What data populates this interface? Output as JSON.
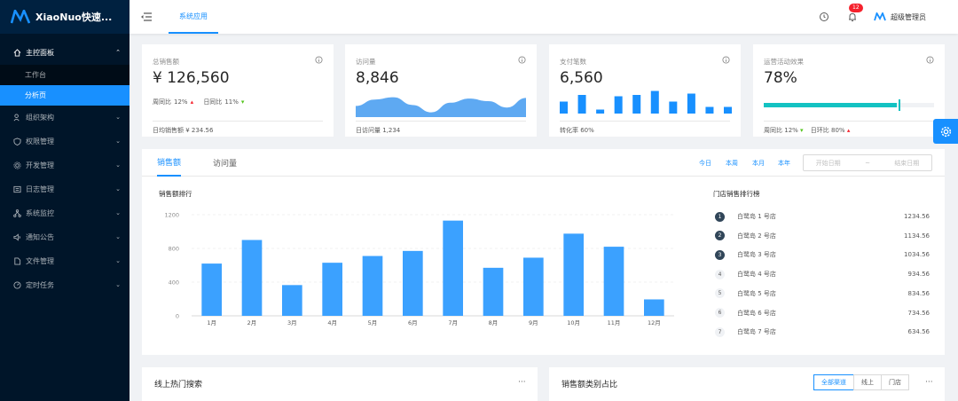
{
  "sidebar": {
    "logo": "XiaoNuo快速...",
    "items": [
      {
        "label": "主控面板",
        "icon": "home-icon"
      },
      {
        "label": "组织架构",
        "icon": "team-icon"
      },
      {
        "label": "权限管理",
        "icon": "safety-icon"
      },
      {
        "label": "开发管理",
        "icon": "setting-icon"
      },
      {
        "label": "日志管理",
        "icon": "log-icon"
      },
      {
        "label": "系统监控",
        "icon": "cluster-icon"
      },
      {
        "label": "通知公告",
        "icon": "sound-icon"
      },
      {
        "label": "文件管理",
        "icon": "file-icon"
      },
      {
        "label": "定时任务",
        "icon": "dashboard-icon"
      }
    ],
    "subitems": [
      {
        "label": "工作台"
      },
      {
        "label": "分析页"
      }
    ]
  },
  "header": {
    "tab": "系统应用",
    "badge": "12",
    "user": "超级管理员"
  },
  "kpi": [
    {
      "title": "总销售额",
      "value": "¥ 126,560",
      "week_label": "周同比",
      "week_val": "12%",
      "day_label": "日同比",
      "day_val": "11%",
      "foot": "日均销售额 ¥ 234.56"
    },
    {
      "title": "访问量",
      "value": "8,846",
      "foot": "日访问量 1,234"
    },
    {
      "title": "支付笔数",
      "value": "6,560",
      "foot": "转化率 60%"
    },
    {
      "title": "运营活动效果",
      "value": "78%",
      "progress": 0.78,
      "week_label": "周同比",
      "week_val": "12%",
      "day_label": "日环比",
      "day_val": "80%"
    }
  ],
  "sales": {
    "tabs": [
      "销售额",
      "访问量"
    ],
    "ranges": [
      "今日",
      "本周",
      "本月",
      "本年"
    ],
    "date_start": "开始日期",
    "date_sep": "~",
    "date_end": "结束日期",
    "chart_title": "销售额排行",
    "rank_title": "门店销售排行榜",
    "ranking": [
      {
        "n": "1",
        "name": "白鹭岛 1 号店",
        "value": "1234.56"
      },
      {
        "n": "2",
        "name": "白鹭岛 2 号店",
        "value": "1134.56"
      },
      {
        "n": "3",
        "name": "白鹭岛 3 号店",
        "value": "1034.56"
      },
      {
        "n": "4",
        "name": "白鹭岛 4 号店",
        "value": "934.56"
      },
      {
        "n": "5",
        "name": "白鹭岛 5 号店",
        "value": "834.56"
      },
      {
        "n": "6",
        "name": "白鹭岛 6 号店",
        "value": "734.56"
      },
      {
        "n": "7",
        "name": "白鹭岛 7 号店",
        "value": "634.56"
      }
    ]
  },
  "bottom": {
    "left_title": "线上热门搜索",
    "right_title": "销售额类别占比",
    "more": "···",
    "seg": [
      "全部渠道",
      "线上",
      "门店"
    ]
  },
  "colors": {
    "accent": "#1890ff",
    "sidebar": "#001529",
    "progress": "#13c2c2"
  },
  "chart_data": {
    "type": "bar",
    "categories": [
      "1月",
      "2月",
      "3月",
      "4月",
      "5月",
      "6月",
      "7月",
      "8月",
      "9月",
      "10月",
      "11月",
      "12月"
    ],
    "values": [
      620,
      900,
      365,
      630,
      710,
      770,
      1130,
      570,
      690,
      975,
      820,
      195
    ],
    "title": "销售额排行",
    "ylim": [
      0,
      1200
    ],
    "yticks": [
      0,
      400,
      800,
      1200
    ],
    "grid": true,
    "color": "#3ba1ff"
  },
  "mini": {
    "area": [
      0.35,
      0.55,
      0.62,
      0.38,
      0.15,
      0.45,
      0.58,
      0.5,
      0.3,
      0.6
    ],
    "bars": [
      0.45,
      0.7,
      0.15,
      0.65,
      0.7,
      0.85,
      0.45,
      0.75,
      0.25,
      0.25
    ]
  }
}
